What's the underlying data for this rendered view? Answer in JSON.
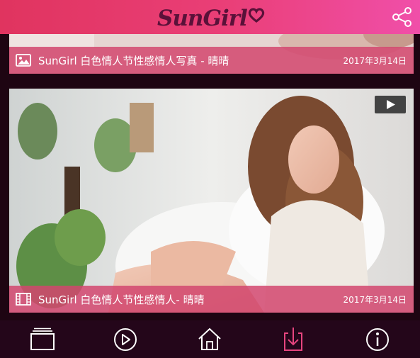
{
  "header": {
    "logo_text": "SunGirl",
    "share_icon": "share-icon"
  },
  "posts": [
    {
      "type": "gallery",
      "type_icon": "image-icon",
      "title": "SunGirl 白色情人节性感情人写真 - 晴晴",
      "date": "2017年3月14日"
    },
    {
      "type": "video",
      "type_icon": "film-icon",
      "badge_icon": "play-badge-icon",
      "title": "SunGirl 白色情人节性感情人- 晴晴",
      "date": "2017年3月14日"
    }
  ],
  "bottom_nav": {
    "items": [
      {
        "name": "albums",
        "icon": "stack-icon",
        "active": false
      },
      {
        "name": "videos",
        "icon": "play-circle-icon",
        "active": false
      },
      {
        "name": "home",
        "icon": "home-icon",
        "active": false
      },
      {
        "name": "downloads",
        "icon": "download-icon",
        "active": true
      },
      {
        "name": "info",
        "icon": "info-icon",
        "active": false
      }
    ]
  },
  "colors": {
    "header_start": "#e0345f",
    "header_end": "#f04fa9",
    "logo": "#5a1139",
    "background": "#1e0512",
    "caption_bar": "#d2466e",
    "nav_icon": "#ffffff",
    "nav_active": "#e8457f"
  }
}
